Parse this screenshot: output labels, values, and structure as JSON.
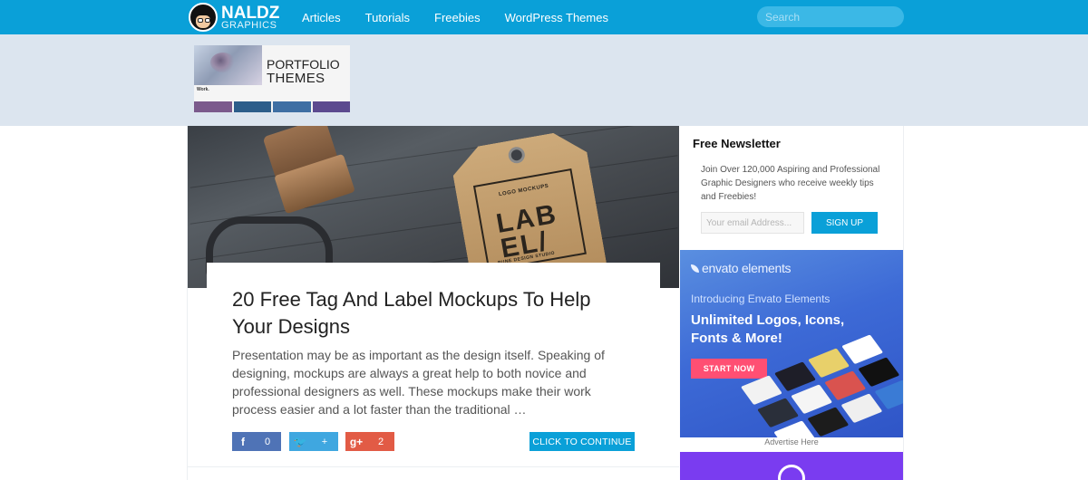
{
  "brand": {
    "name": "NALDZ",
    "tagline": "GRAPHICS"
  },
  "nav": {
    "items": [
      "Articles",
      "Tutorials",
      "Freebies",
      "WordPress Themes"
    ]
  },
  "search": {
    "placeholder": "Search"
  },
  "promo": {
    "line1": "PORTFOLIO",
    "line2": "THEMES",
    "work_label": "Work."
  },
  "post": {
    "hero_tag": {
      "small": "LOGO MOCKUPS",
      "line1": "LAB",
      "line2": "EL/",
      "foot": "PUNE DESIGN STUDIO"
    },
    "title": "20 Free Tag And Label Mockups To Help Your Designs",
    "excerpt": "Presentation may be as important as the design itself. Speaking of designing, mockups are always a great help to both novice and professional designers as well. These mockups make their work process easier and a lot faster than the traditional …",
    "share": {
      "facebook": {
        "icon": "f",
        "count": "0"
      },
      "twitter": {
        "icon": "🐦",
        "count": "+"
      },
      "googleplus": {
        "icon": "g+",
        "count": "2"
      }
    },
    "continue_label": "CLICK TO CONTINUE"
  },
  "newsletter": {
    "title": "Free Newsletter",
    "text": "Join Over 120,000 Aspiring and Professional Graphic Designers who receive weekly tips and Freebies!",
    "email_placeholder": "Your email Address...",
    "signup_label": "SIGN UP"
  },
  "ad": {
    "brand": "envato elements",
    "intro": "Introducing Envato Elements",
    "headline": "Unlimited Logos, Icons, Fonts & More!",
    "cta": "START NOW",
    "caption": "Advertise Here"
  },
  "colors": {
    "topbar": "#0aa0d8",
    "banner_bg": "#dce5ef",
    "facebook": "#4f73b6",
    "twitter": "#3fa7e0",
    "googleplus": "#e25b45",
    "ad_blue": "#3d6ad6",
    "ad_cta": "#ff4f73",
    "purple": "#7a3cf0"
  }
}
